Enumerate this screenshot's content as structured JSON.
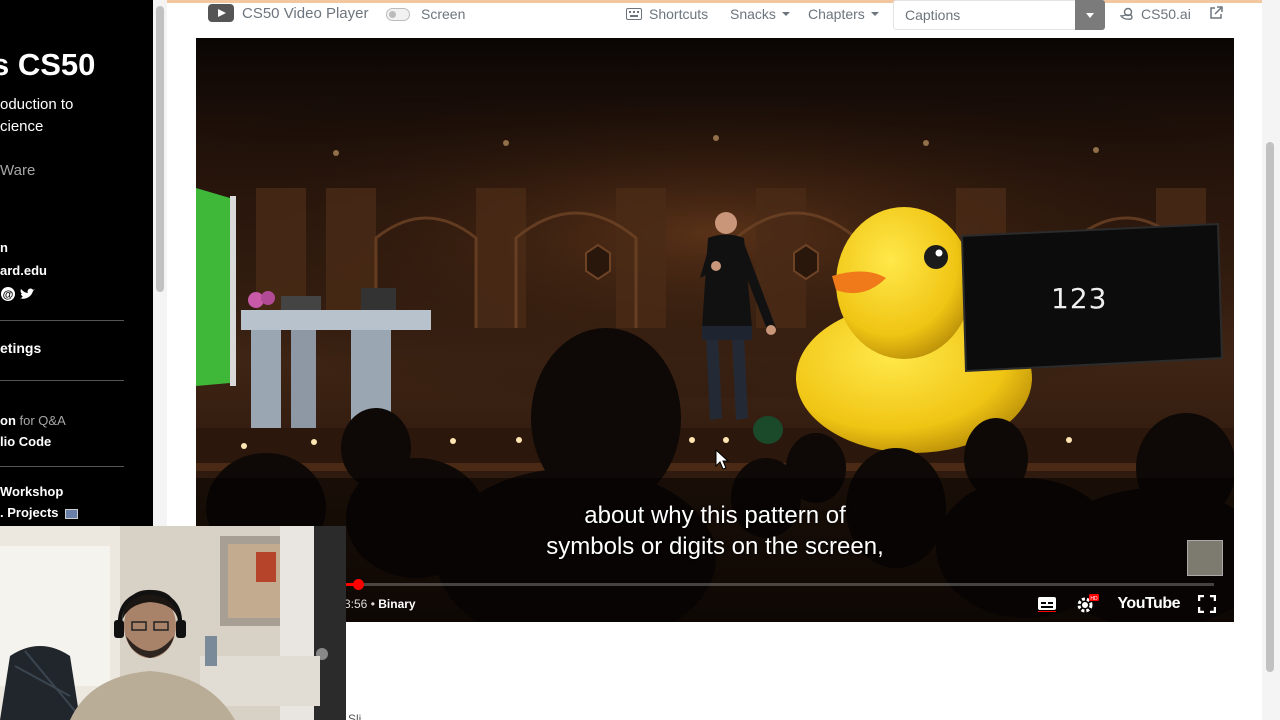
{
  "sidebar": {
    "title": "s CS50",
    "subtitle_line1": "oduction to",
    "subtitle_line2": "cience",
    "author_partial": "Ware",
    "contact_line1": "n",
    "contact_line2": "ard.edu",
    "meetings_partial": "etings",
    "qa_prefix": "on",
    "qa_suffix": " for Q&A",
    "vscode_partial": "lio Code",
    "workshop_partial": "Workshop",
    "projects_partial": ". Projects"
  },
  "toolbar": {
    "player_title": "CS50 Video Player",
    "screen_label": "Screen",
    "shortcuts_label": "Shortcuts",
    "snacks_label": "Snacks",
    "chapters_label": "Chapters",
    "captions_label": "Captions",
    "cs50ai_label": "CS50.ai"
  },
  "video": {
    "subtitle_line1": "about why this pattern of",
    "subtitle_line2": "symbols or digits on the screen,",
    "screen_number": "123",
    "time": "3:56",
    "separator": " • ",
    "chapter": "Binary",
    "youtube_label": "YouTube",
    "progress_fraction": 0.014
  },
  "footer": {
    "partial_text": "Sli"
  },
  "colors": {
    "accent_red": "#ff0000",
    "duck_yellow": "#f5d21a",
    "toolbar_text": "#6c757d"
  }
}
